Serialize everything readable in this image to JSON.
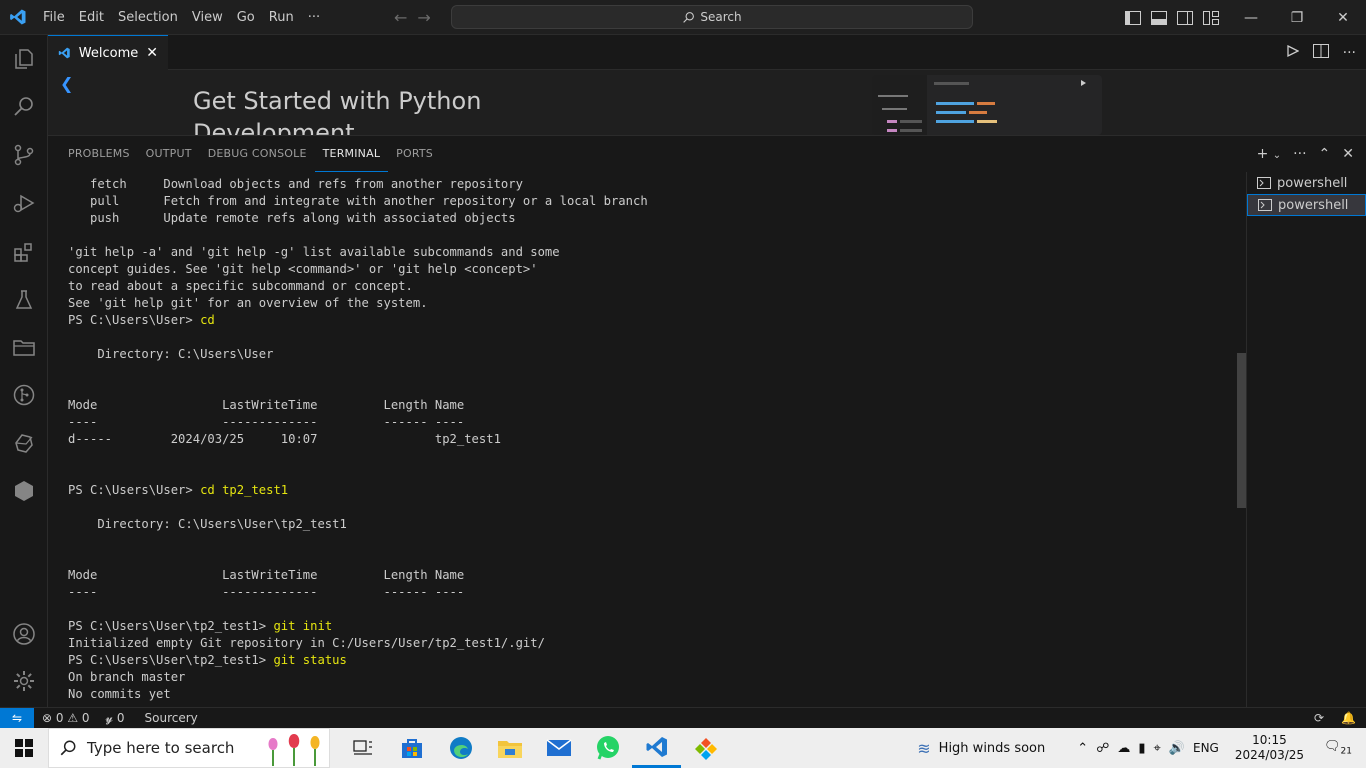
{
  "menu": [
    "File",
    "Edit",
    "Selection",
    "View",
    "Go",
    "Run",
    "···"
  ],
  "search": {
    "label": "Search"
  },
  "tab": {
    "label": "Welcome"
  },
  "welcome": {
    "title": "Get Started with Python Development"
  },
  "panel": {
    "tabs": [
      "PROBLEMS",
      "OUTPUT",
      "DEBUG CONSOLE",
      "TERMINAL",
      "PORTS"
    ],
    "active_tab": "TERMINAL"
  },
  "terminal_lines": [
    {
      "t": "   fetch     Download objects and refs from another repository"
    },
    {
      "t": "   pull      Fetch from and integrate with another repository or a local branch"
    },
    {
      "t": "   push      Update remote refs along with associated objects"
    },
    {
      "t": ""
    },
    {
      "t": "'git help -a' and 'git help -g' list available subcommands and some"
    },
    {
      "t": "concept guides. See 'git help <command>' or 'git help <concept>'"
    },
    {
      "t": "to read about a specific subcommand or concept."
    },
    {
      "t": "See 'git help git' for an overview of the system."
    },
    {
      "p": "PS C:\\Users\\User> ",
      "c": "cd"
    },
    {
      "t": ""
    },
    {
      "t": "    Directory: C:\\Users\\User"
    },
    {
      "t": ""
    },
    {
      "t": ""
    },
    {
      "t": "Mode                 LastWriteTime         Length Name"
    },
    {
      "t": "----                 -------------         ------ ----"
    },
    {
      "t": "d-----        2024/03/25     10:07                tp2_test1"
    },
    {
      "t": ""
    },
    {
      "t": ""
    },
    {
      "p": "PS C:\\Users\\User> ",
      "c": "cd tp2_test1"
    },
    {
      "t": ""
    },
    {
      "t": "    Directory: C:\\Users\\User\\tp2_test1"
    },
    {
      "t": ""
    },
    {
      "t": ""
    },
    {
      "t": "Mode                 LastWriteTime         Length Name"
    },
    {
      "t": "----                 -------------         ------ ----"
    },
    {
      "t": ""
    },
    {
      "p": "PS C:\\Users\\User\\tp2_test1> ",
      "c": "git init"
    },
    {
      "t": "Initialized empty Git repository in C:/Users/User/tp2_test1/.git/"
    },
    {
      "p": "PS C:\\Users\\User\\tp2_test1> ",
      "c": "git status"
    },
    {
      "t": "On branch master"
    },
    {
      "t": "No commits yet"
    }
  ],
  "terminals": [
    "powershell",
    "powershell"
  ],
  "status": {
    "errors": "0",
    "warnings": "0",
    "ports": "0",
    "sourcery": "Sourcery"
  },
  "taskbar": {
    "search_placeholder": "Type here to search",
    "weather": "High winds soon",
    "lang": "ENG",
    "time": "10:15",
    "date": "2024/03/25",
    "notifications": "21"
  },
  "colors": {
    "accent": "#0078d4",
    "command": "#e5e510"
  }
}
